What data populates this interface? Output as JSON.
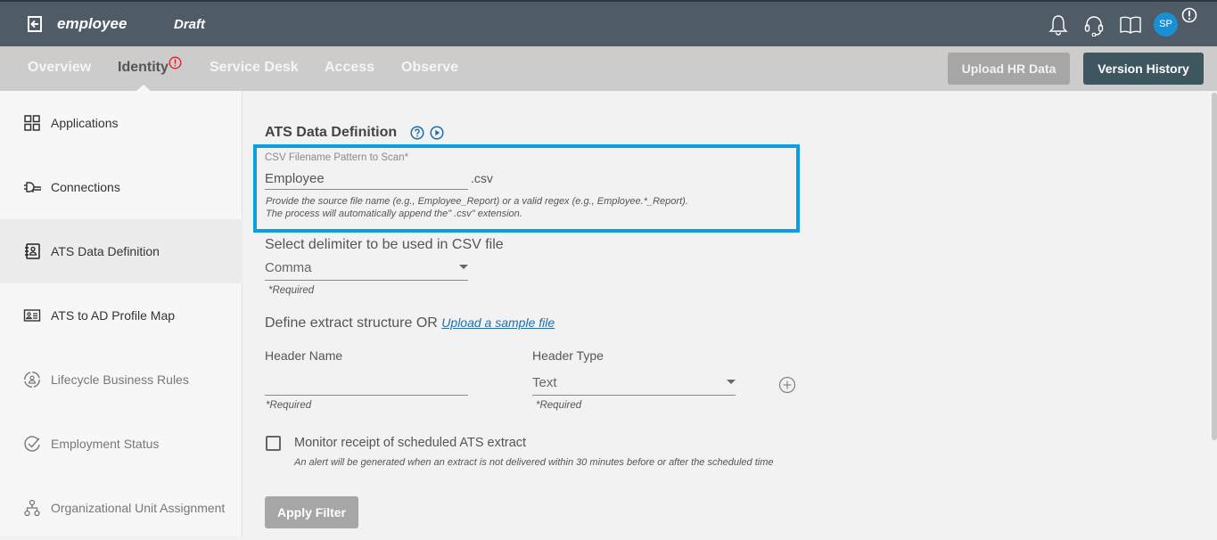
{
  "header": {
    "app_name": "employee",
    "status": "Draft",
    "avatar_initials": "SP",
    "icons": [
      "back-icon",
      "bell-icon",
      "headset-icon",
      "book-icon",
      "alert-icon"
    ]
  },
  "nav": {
    "tabs": [
      {
        "label": "Overview",
        "active": false
      },
      {
        "label": "Identity",
        "active": true,
        "alert": true
      },
      {
        "label": "Service Desk",
        "active": false
      },
      {
        "label": "Access",
        "active": false
      },
      {
        "label": "Observe",
        "active": false
      }
    ],
    "upload_label": "Upload HR Data",
    "version_label": "Version History"
  },
  "sidebar": {
    "items": [
      {
        "label": "Applications",
        "icon": "grid-icon"
      },
      {
        "label": "Connections",
        "icon": "plug-icon"
      },
      {
        "label": "ATS Data Definition",
        "icon": "contact-book-icon",
        "active": true
      },
      {
        "label": "ATS to AD Profile Map",
        "icon": "id-card-icon"
      },
      {
        "label": "Lifecycle Business Rules",
        "icon": "lifecycle-user-icon"
      },
      {
        "label": "Employment Status",
        "icon": "check-circle-icon"
      },
      {
        "label": "Organizational Unit Assignment",
        "icon": "org-chart-icon"
      }
    ]
  },
  "form": {
    "title": "ATS Data Definition",
    "csv_label": "CSV Filename Pattern to Scan*",
    "csv_value": "Employee",
    "csv_ext": ".csv",
    "csv_help_1": "Provide the source file name (e.g., Employee_Report) or a valid regex (e.g., Employee.*_Report).",
    "csv_help_2": "The process will automatically append the\" .csv\" extension.",
    "delimiter_label": "Select delimiter to be used in CSV file",
    "delimiter_value": "Comma",
    "required": "*Required",
    "define_text": "Define extract structure OR ",
    "upload_sample": "Upload a sample file",
    "header_name_label": "Header Name",
    "header_name_value": "",
    "header_type_label": "Header Type",
    "header_type_value": "Text",
    "monitor_label": "Monitor receipt of scheduled ATS extract",
    "monitor_checked": false,
    "monitor_help": "An alert will be generated when an extract is not delivered within 30 minutes before or after the scheduled time",
    "apply_label": "Apply Filter"
  }
}
